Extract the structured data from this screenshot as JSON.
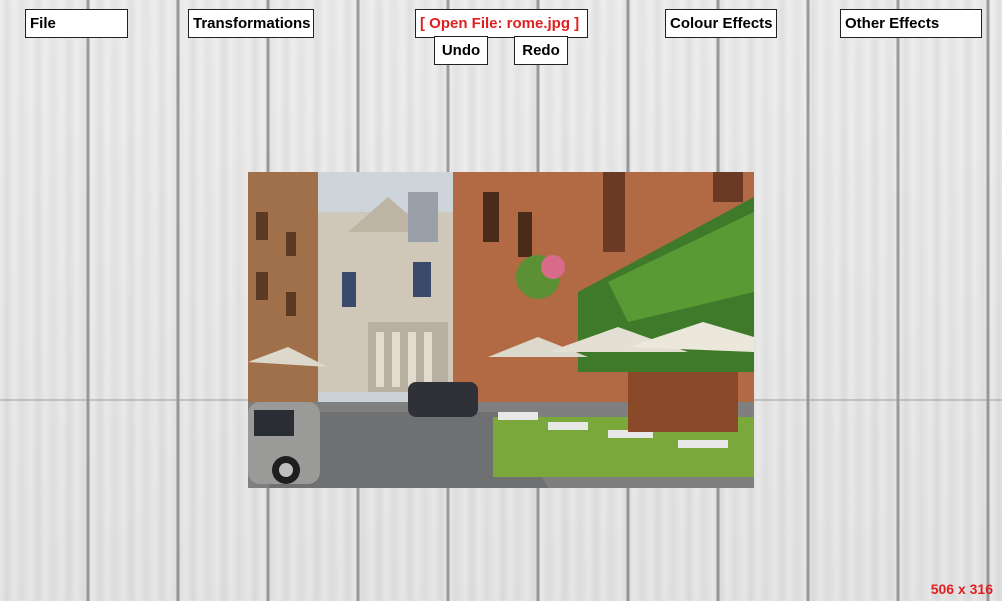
{
  "theme": {
    "accent": "#e02020"
  },
  "toolbar": {
    "file_label": "File",
    "transformations_label": "Transformations",
    "open_file_label": "[ Open File: rome.jpg ]",
    "undo_label": "Undo",
    "redo_label": "Redo",
    "colour_effects_label": "Colour Effects",
    "other_effects_label": "Other Effects"
  },
  "image": {
    "dimensions_label": "506 x 316"
  }
}
